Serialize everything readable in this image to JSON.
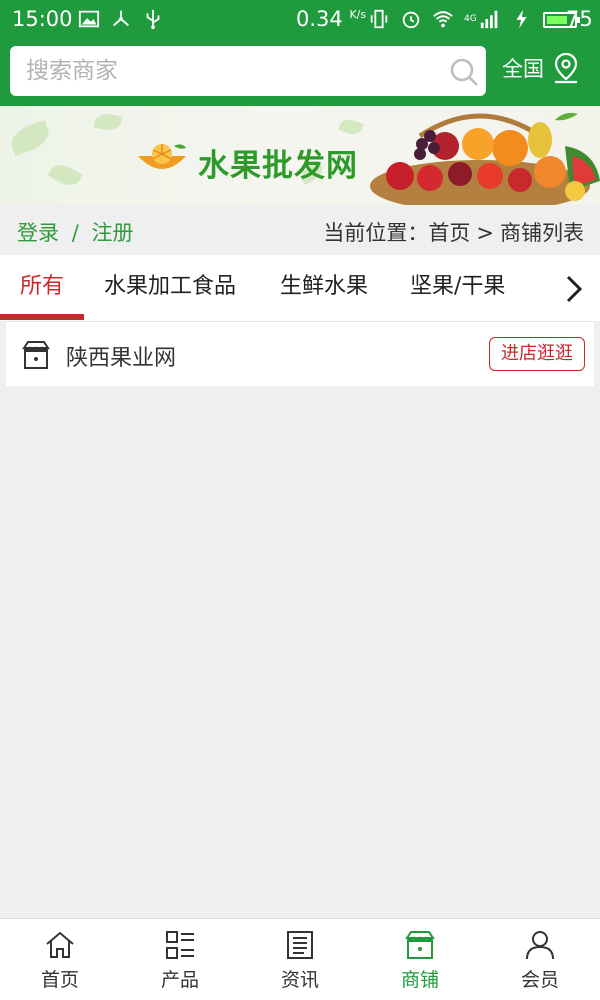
{
  "status_bar": {
    "time": "15:00",
    "speed": "0.34",
    "speed_unit": "K/s",
    "battery": "75",
    "network": "4G",
    "battery_level_percent": 75
  },
  "search": {
    "placeholder": "搜索商家",
    "value": ""
  },
  "region": {
    "label": "全国"
  },
  "banner": {
    "title": "水果批发网"
  },
  "location_bar": {
    "login": "登录",
    "divider": "/",
    "register": "注册",
    "current_label": "当前位置：",
    "crumbs": [
      "首页",
      "商铺列表"
    ],
    "crumb_sep": ">"
  },
  "tabs": [
    {
      "label": "所有",
      "active": true
    },
    {
      "label": "水果加工食品",
      "active": false
    },
    {
      "label": "生鲜水果",
      "active": false
    },
    {
      "label": "坚果/干果",
      "active": false
    }
  ],
  "shops": [
    {
      "name": "陕西果业网",
      "action": "进店逛逛"
    }
  ],
  "bottom_nav": [
    {
      "label": "首页",
      "icon": "home-icon",
      "active": false
    },
    {
      "label": "产品",
      "icon": "grid-list-icon",
      "active": false
    },
    {
      "label": "资讯",
      "icon": "news-icon",
      "active": false
    },
    {
      "label": "商铺",
      "icon": "store-icon",
      "active": true
    },
    {
      "label": "会员",
      "icon": "user-icon",
      "active": false
    }
  ],
  "colors": {
    "primary_green": "#1f9a3c",
    "accent_red": "#c9282d",
    "background": "#efefef"
  }
}
